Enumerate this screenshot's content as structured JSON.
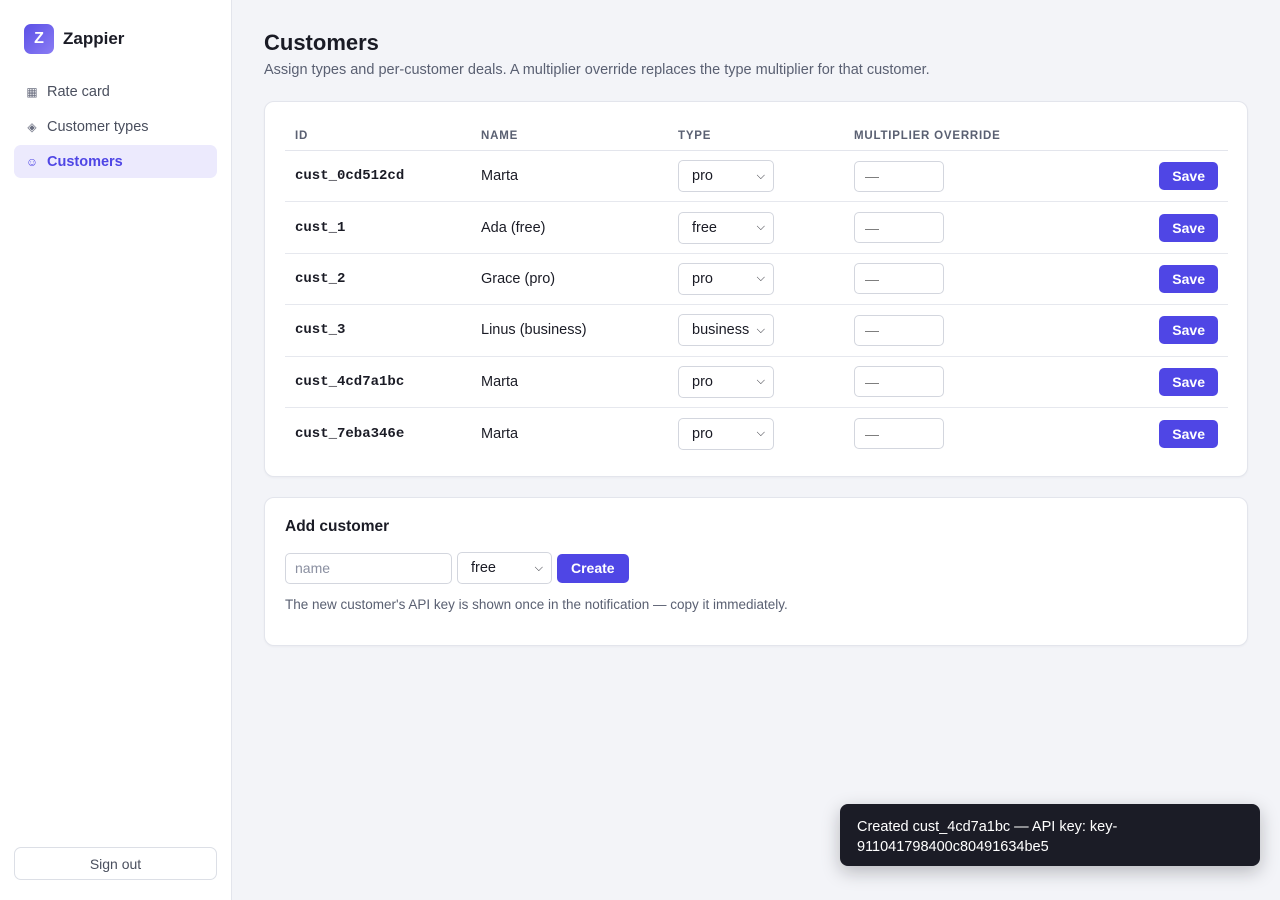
{
  "app": {
    "logo_letter": "Z",
    "name": "Zappier",
    "accent_color": "#4f46e5"
  },
  "sidebar": {
    "items": [
      {
        "label": "Rate card",
        "icon": "grid-icon",
        "glyph": "▦",
        "active": false
      },
      {
        "label": "Customer types",
        "icon": "diamond-icon",
        "glyph": "◈",
        "active": false
      },
      {
        "label": "Customers",
        "icon": "smiley-icon",
        "glyph": "☺",
        "active": true
      }
    ],
    "sign_out": "Sign out"
  },
  "page": {
    "title": "Customers",
    "subtitle": "Assign types and per-customer deals. A multiplier override replaces the type multiplier for that customer."
  },
  "table": {
    "headers": {
      "id": "ID",
      "name": "Name",
      "type": "Type",
      "multiplier": "Multiplier override"
    },
    "save_label": "Save",
    "mult_placeholder": "—",
    "rows": [
      {
        "id": "cust_0cd512cd",
        "name": "Marta",
        "type": "pro"
      },
      {
        "id": "cust_1",
        "name": "Ada (free)",
        "type": "free"
      },
      {
        "id": "cust_2",
        "name": "Grace (pro)",
        "type": "pro"
      },
      {
        "id": "cust_3",
        "name": "Linus (business)",
        "type": "business"
      },
      {
        "id": "cust_4cd7a1bc",
        "name": "Marta",
        "type": "pro"
      },
      {
        "id": "cust_7eba346e",
        "name": "Marta",
        "type": "pro"
      }
    ]
  },
  "add_customer": {
    "title": "Add customer",
    "name_placeholder": "name",
    "type_value": "free",
    "create_label": "Create",
    "hint": "The new customer's API key is shown once in the notification — copy it immediately."
  },
  "toast": {
    "message": "Created cust_4cd7a1bc — API key: key-911041798400c80491634be5"
  }
}
